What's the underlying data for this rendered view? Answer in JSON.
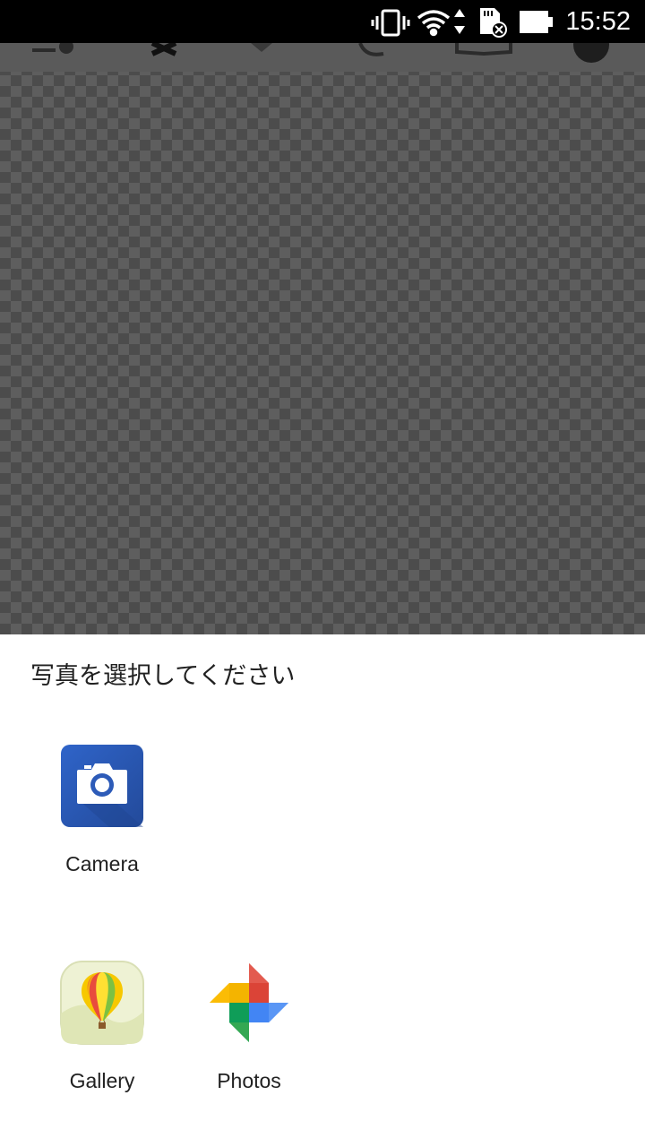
{
  "status_bar": {
    "time": "15:52",
    "icons": [
      "vibrate-icon",
      "wifi-icon",
      "data-arrows-icon",
      "sd-card-error-icon",
      "battery-icon"
    ]
  },
  "background": {
    "toolbar_icons": [
      "add-layer-icon",
      "close-icon",
      "dropdown-icon",
      "undo-icon",
      "book-icon",
      "info-icon"
    ]
  },
  "chooser": {
    "title": "写真を選択してください",
    "apps": [
      {
        "label": "Camera",
        "icon": "camera-icon",
        "accent": "#2d5bb8"
      },
      {
        "label": "Gallery",
        "icon": "balloon-icon",
        "accent": "#e8edc8"
      },
      {
        "label": "Photos",
        "icon": "pinwheel-icon",
        "accent": "#4285f4"
      }
    ]
  }
}
